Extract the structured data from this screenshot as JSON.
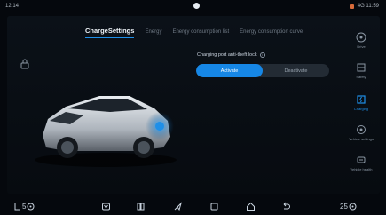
{
  "status": {
    "time": "12:14",
    "right_text": "4G 11:59"
  },
  "tabs": [
    {
      "label": "ChargeSettings",
      "active": true
    },
    {
      "label": "Energy",
      "active": false
    },
    {
      "label": "Energy consumption list",
      "active": false
    },
    {
      "label": "Energy consumption curve",
      "active": false
    }
  ],
  "charging_port": {
    "title": "Charging port anti-theft lock",
    "options": [
      "Activate",
      "Deactivate"
    ],
    "selected": "Activate"
  },
  "sidebar": {
    "items": [
      {
        "label": "Drive",
        "icon": "steering-wheel-icon",
        "active": false
      },
      {
        "label": "Safety",
        "icon": "shield-icon",
        "active": false
      },
      {
        "label": "Charging",
        "icon": "charging-icon",
        "active": true
      },
      {
        "label": "Vehicle settings",
        "icon": "settings-icon",
        "active": false
      },
      {
        "label": "Vehicle health",
        "icon": "car-health-icon",
        "active": false
      }
    ]
  },
  "dock": {
    "temp_left": "5",
    "temp_right": "25"
  },
  "colors": {
    "accent": "#1687e6",
    "background": "#05080d"
  }
}
